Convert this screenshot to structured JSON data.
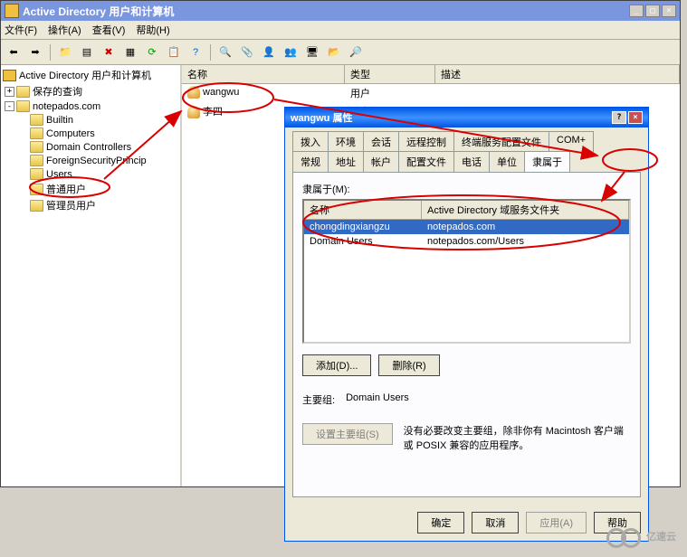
{
  "main_window": {
    "title": "Active Directory 用户和计算机",
    "menus": {
      "file": "文件(F)",
      "action": "操作(A)",
      "view": "查看(V)",
      "help": "帮助(H)"
    }
  },
  "tree": {
    "root": "Active Directory 用户和计算机",
    "saved_queries": "保存的查询",
    "domain": "notepados.com",
    "builtin": "Builtin",
    "computers": "Computers",
    "domain_controllers": "Domain Controllers",
    "foreign": "ForeignSecurityPrincip",
    "users": "Users",
    "normal_users": "普通用户",
    "admin_users": "管理员用户"
  },
  "list": {
    "col_name": "名称",
    "col_type": "类型",
    "col_desc": "描述",
    "rows": [
      {
        "name": "wangwu",
        "type": "用户"
      },
      {
        "name": "李四",
        "type": "用户"
      }
    ]
  },
  "dialog": {
    "title": "wangwu 属性",
    "tabs": {
      "dial": "拨入",
      "env": "环境",
      "session": "会话",
      "remote": "远程控制",
      "terminal": "终端服务配置文件",
      "com": "COM+",
      "general": "常规",
      "address": "地址",
      "account": "帐户",
      "profile": "配置文件",
      "phone": "电话",
      "org": "单位",
      "memberof": "隶属于"
    },
    "memberof_label": "隶属于(M):",
    "mol_col_name": "名称",
    "mol_col_folder": "Active Directory 域服务文件夹",
    "mol_rows": [
      {
        "name": "chongdingxiangzu",
        "folder": "notepados.com"
      },
      {
        "name": "Domain Users",
        "folder": "notepados.com/Users"
      }
    ],
    "add_btn": "添加(D)...",
    "delete_btn": "删除(R)",
    "primary_label": "主要组:",
    "primary_value": "Domain Users",
    "set_primary_btn": "设置主要组(S)",
    "primary_note": "没有必要改变主要组，除非你有 Macintosh 客户端或 POSIX 兼容的应用程序。",
    "ok": "确定",
    "cancel": "取消",
    "apply": "应用(A)",
    "help": "帮助"
  },
  "watermark": "亿速云"
}
